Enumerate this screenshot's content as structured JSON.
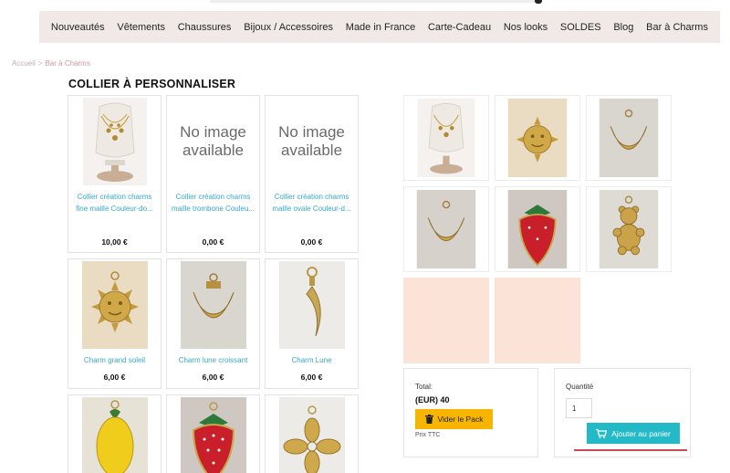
{
  "nav": {
    "items": [
      "Nouveautés",
      "Vêtements",
      "Chaussures",
      "Bijoux / Accessoires",
      "Made in France",
      "Carte-Cadeau",
      "Nos looks",
      "SOLDES",
      "Blog",
      "Bar à Charms"
    ]
  },
  "breadcrumb": {
    "home": "Accueil",
    "separator": ">",
    "current": "Bar à Charms"
  },
  "page_title": "COLLIER À PERSONNALISER",
  "products": [
    {
      "name": "Collier création charms fine maille Couleur-do...",
      "price": "10,00 €",
      "image": "necklace-bust"
    },
    {
      "name": "Collier création charms maille trombone Couleu...",
      "price": "0,00 €",
      "image": "none",
      "no_image_text": "No image available"
    },
    {
      "name": "Collier création charms maille ovale Couleur-d...",
      "price": "0,00 €",
      "image": "none",
      "no_image_text": "No image available"
    },
    {
      "name": "Charm grand soleil",
      "price": "6,00 €",
      "image": "sun-charm"
    },
    {
      "name": "Charm lune croissant",
      "price": "6,00 €",
      "image": "crescent-charm"
    },
    {
      "name": "Charm Lune",
      "price": "6,00 €",
      "image": "moon-charm"
    },
    {
      "name": "",
      "price": "",
      "image": "lemon-charm"
    },
    {
      "name": "",
      "price": "",
      "image": "strawberry-charm"
    },
    {
      "name": "",
      "price": "",
      "image": "flower-charm"
    }
  ],
  "pack": {
    "thumbs": [
      "necklace-bust",
      "sun-charm",
      "crescent-charm",
      "crescent-charm",
      "strawberry-charm",
      "bear-charm"
    ],
    "total_label": "Total:",
    "total_value": "(EUR) 40",
    "empty_button": "Vider le Pack",
    "tax_note": "Prix TTC"
  },
  "cart": {
    "quantity_label": "Quantité",
    "quantity_value": "1",
    "add_button": "Ajouter au panier"
  },
  "colors": {
    "nav_bg": "#f1e9e6",
    "link": "#36a8c8",
    "empty_button": "#f8b500",
    "cart_button": "#24b9c6",
    "slot_placeholder": "#fbe3d8",
    "accent_line": "#c94955"
  }
}
